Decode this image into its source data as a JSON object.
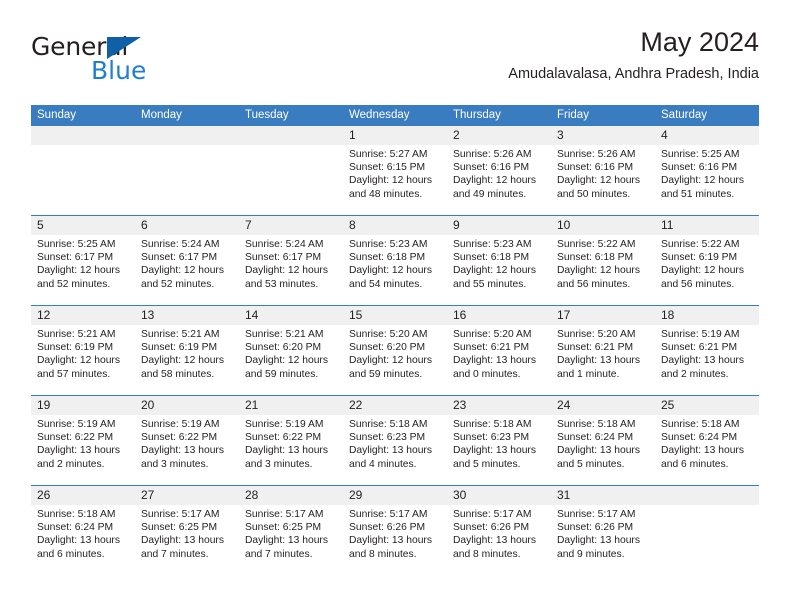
{
  "brand": {
    "name_part1": "General",
    "name_part2": "Blue",
    "triangle_color": "#1060a8",
    "blue_color": "#1f7fd0"
  },
  "header": {
    "title": "May 2024",
    "subtitle": "Amudalavalasa, Andhra Pradesh, India"
  },
  "calendar": {
    "header_bg": "#3a7cc0",
    "daynum_bg": "#f0f0f0",
    "weekdays": [
      "Sunday",
      "Monday",
      "Tuesday",
      "Wednesday",
      "Thursday",
      "Friday",
      "Saturday"
    ],
    "weeks": [
      [
        {
          "day": "",
          "sunrise": "",
          "sunset": "",
          "daylight_line1": "",
          "daylight_line2": "",
          "empty": true
        },
        {
          "day": "",
          "sunrise": "",
          "sunset": "",
          "daylight_line1": "",
          "daylight_line2": "",
          "empty": true
        },
        {
          "day": "",
          "sunrise": "",
          "sunset": "",
          "daylight_line1": "",
          "daylight_line2": "",
          "empty": true
        },
        {
          "day": "1",
          "sunrise": "Sunrise: 5:27 AM",
          "sunset": "Sunset: 6:15 PM",
          "daylight_line1": "Daylight: 12 hours",
          "daylight_line2": "and 48 minutes."
        },
        {
          "day": "2",
          "sunrise": "Sunrise: 5:26 AM",
          "sunset": "Sunset: 6:16 PM",
          "daylight_line1": "Daylight: 12 hours",
          "daylight_line2": "and 49 minutes."
        },
        {
          "day": "3",
          "sunrise": "Sunrise: 5:26 AM",
          "sunset": "Sunset: 6:16 PM",
          "daylight_line1": "Daylight: 12 hours",
          "daylight_line2": "and 50 minutes."
        },
        {
          "day": "4",
          "sunrise": "Sunrise: 5:25 AM",
          "sunset": "Sunset: 6:16 PM",
          "daylight_line1": "Daylight: 12 hours",
          "daylight_line2": "and 51 minutes."
        }
      ],
      [
        {
          "day": "5",
          "sunrise": "Sunrise: 5:25 AM",
          "sunset": "Sunset: 6:17 PM",
          "daylight_line1": "Daylight: 12 hours",
          "daylight_line2": "and 52 minutes."
        },
        {
          "day": "6",
          "sunrise": "Sunrise: 5:24 AM",
          "sunset": "Sunset: 6:17 PM",
          "daylight_line1": "Daylight: 12 hours",
          "daylight_line2": "and 52 minutes."
        },
        {
          "day": "7",
          "sunrise": "Sunrise: 5:24 AM",
          "sunset": "Sunset: 6:17 PM",
          "daylight_line1": "Daylight: 12 hours",
          "daylight_line2": "and 53 minutes."
        },
        {
          "day": "8",
          "sunrise": "Sunrise: 5:23 AM",
          "sunset": "Sunset: 6:18 PM",
          "daylight_line1": "Daylight: 12 hours",
          "daylight_line2": "and 54 minutes."
        },
        {
          "day": "9",
          "sunrise": "Sunrise: 5:23 AM",
          "sunset": "Sunset: 6:18 PM",
          "daylight_line1": "Daylight: 12 hours",
          "daylight_line2": "and 55 minutes."
        },
        {
          "day": "10",
          "sunrise": "Sunrise: 5:22 AM",
          "sunset": "Sunset: 6:18 PM",
          "daylight_line1": "Daylight: 12 hours",
          "daylight_line2": "and 56 minutes."
        },
        {
          "day": "11",
          "sunrise": "Sunrise: 5:22 AM",
          "sunset": "Sunset: 6:19 PM",
          "daylight_line1": "Daylight: 12 hours",
          "daylight_line2": "and 56 minutes."
        }
      ],
      [
        {
          "day": "12",
          "sunrise": "Sunrise: 5:21 AM",
          "sunset": "Sunset: 6:19 PM",
          "daylight_line1": "Daylight: 12 hours",
          "daylight_line2": "and 57 minutes."
        },
        {
          "day": "13",
          "sunrise": "Sunrise: 5:21 AM",
          "sunset": "Sunset: 6:19 PM",
          "daylight_line1": "Daylight: 12 hours",
          "daylight_line2": "and 58 minutes."
        },
        {
          "day": "14",
          "sunrise": "Sunrise: 5:21 AM",
          "sunset": "Sunset: 6:20 PM",
          "daylight_line1": "Daylight: 12 hours",
          "daylight_line2": "and 59 minutes."
        },
        {
          "day": "15",
          "sunrise": "Sunrise: 5:20 AM",
          "sunset": "Sunset: 6:20 PM",
          "daylight_line1": "Daylight: 12 hours",
          "daylight_line2": "and 59 minutes."
        },
        {
          "day": "16",
          "sunrise": "Sunrise: 5:20 AM",
          "sunset": "Sunset: 6:21 PM",
          "daylight_line1": "Daylight: 13 hours",
          "daylight_line2": "and 0 minutes."
        },
        {
          "day": "17",
          "sunrise": "Sunrise: 5:20 AM",
          "sunset": "Sunset: 6:21 PM",
          "daylight_line1": "Daylight: 13 hours",
          "daylight_line2": "and 1 minute."
        },
        {
          "day": "18",
          "sunrise": "Sunrise: 5:19 AM",
          "sunset": "Sunset: 6:21 PM",
          "daylight_line1": "Daylight: 13 hours",
          "daylight_line2": "and 2 minutes."
        }
      ],
      [
        {
          "day": "19",
          "sunrise": "Sunrise: 5:19 AM",
          "sunset": "Sunset: 6:22 PM",
          "daylight_line1": "Daylight: 13 hours",
          "daylight_line2": "and 2 minutes."
        },
        {
          "day": "20",
          "sunrise": "Sunrise: 5:19 AM",
          "sunset": "Sunset: 6:22 PM",
          "daylight_line1": "Daylight: 13 hours",
          "daylight_line2": "and 3 minutes."
        },
        {
          "day": "21",
          "sunrise": "Sunrise: 5:19 AM",
          "sunset": "Sunset: 6:22 PM",
          "daylight_line1": "Daylight: 13 hours",
          "daylight_line2": "and 3 minutes."
        },
        {
          "day": "22",
          "sunrise": "Sunrise: 5:18 AM",
          "sunset": "Sunset: 6:23 PM",
          "daylight_line1": "Daylight: 13 hours",
          "daylight_line2": "and 4 minutes."
        },
        {
          "day": "23",
          "sunrise": "Sunrise: 5:18 AM",
          "sunset": "Sunset: 6:23 PM",
          "daylight_line1": "Daylight: 13 hours",
          "daylight_line2": "and 5 minutes."
        },
        {
          "day": "24",
          "sunrise": "Sunrise: 5:18 AM",
          "sunset": "Sunset: 6:24 PM",
          "daylight_line1": "Daylight: 13 hours",
          "daylight_line2": "and 5 minutes."
        },
        {
          "day": "25",
          "sunrise": "Sunrise: 5:18 AM",
          "sunset": "Sunset: 6:24 PM",
          "daylight_line1": "Daylight: 13 hours",
          "daylight_line2": "and 6 minutes."
        }
      ],
      [
        {
          "day": "26",
          "sunrise": "Sunrise: 5:18 AM",
          "sunset": "Sunset: 6:24 PM",
          "daylight_line1": "Daylight: 13 hours",
          "daylight_line2": "and 6 minutes."
        },
        {
          "day": "27",
          "sunrise": "Sunrise: 5:17 AM",
          "sunset": "Sunset: 6:25 PM",
          "daylight_line1": "Daylight: 13 hours",
          "daylight_line2": "and 7 minutes."
        },
        {
          "day": "28",
          "sunrise": "Sunrise: 5:17 AM",
          "sunset": "Sunset: 6:25 PM",
          "daylight_line1": "Daylight: 13 hours",
          "daylight_line2": "and 7 minutes."
        },
        {
          "day": "29",
          "sunrise": "Sunrise: 5:17 AM",
          "sunset": "Sunset: 6:26 PM",
          "daylight_line1": "Daylight: 13 hours",
          "daylight_line2": "and 8 minutes."
        },
        {
          "day": "30",
          "sunrise": "Sunrise: 5:17 AM",
          "sunset": "Sunset: 6:26 PM",
          "daylight_line1": "Daylight: 13 hours",
          "daylight_line2": "and 8 minutes."
        },
        {
          "day": "31",
          "sunrise": "Sunrise: 5:17 AM",
          "sunset": "Sunset: 6:26 PM",
          "daylight_line1": "Daylight: 13 hours",
          "daylight_line2": "and 9 minutes."
        },
        {
          "day": "",
          "sunrise": "",
          "sunset": "",
          "daylight_line1": "",
          "daylight_line2": "",
          "empty": true
        }
      ]
    ]
  }
}
